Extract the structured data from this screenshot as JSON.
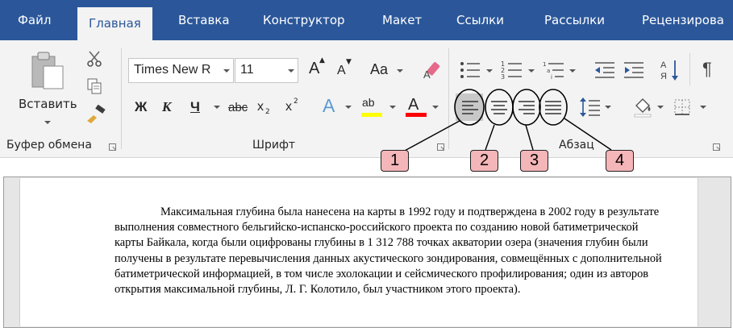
{
  "tabs": [
    "Файл",
    "Главная",
    "Вставка",
    "Конструктор",
    "Макет",
    "Ссылки",
    "Рассылки",
    "Рецензирова"
  ],
  "active_tab": "Главная",
  "clipboard": {
    "paste_label": "Вставить",
    "group_label": "Буфер обмена"
  },
  "font": {
    "font_name": "Times New R",
    "font_size": "11",
    "change_case_label": "Aa",
    "bold": "Ж",
    "italic": "К",
    "underline": "Ч",
    "strike": "abc",
    "subscript": "x",
    "superscript": "x",
    "sub_mark": "2",
    "sup_mark": "2",
    "grow": "A",
    "shrink": "A",
    "effects": "A",
    "highlight": "ab",
    "color": "A",
    "group_label": "Шрифт"
  },
  "paragraph": {
    "group_label": "Абзац",
    "pilcrow": "¶"
  },
  "callouts": [
    "1",
    "2",
    "3",
    "4"
  ],
  "document": {
    "paragraph": "Максимальная глубина была нанесена на карты в 1992 году и подтверждена в 2002 году в результате выполнения совместного бельгийско-испанско-российского проекта по созданию новой батиметрической карты Байкала, когда были оцифрованы глубины в 1 312 788 точках акватории озера (значения глубин были получены в результате перевычисления данных акустического зондирования, совмещённых с дополнительной батиметрической информацией, в том числе эхолокации и сейсмического профилирования; один из авторов открытия максимальной глубины, Л. Г. Колотило, был участником этого проекта)."
  },
  "colors": {
    "tabbar": "#2b579a",
    "ribbon": "#f3f3f3",
    "callout_fill": "#f4b6b8",
    "highlight": "#ffff00",
    "font_color": "#ff0000"
  }
}
